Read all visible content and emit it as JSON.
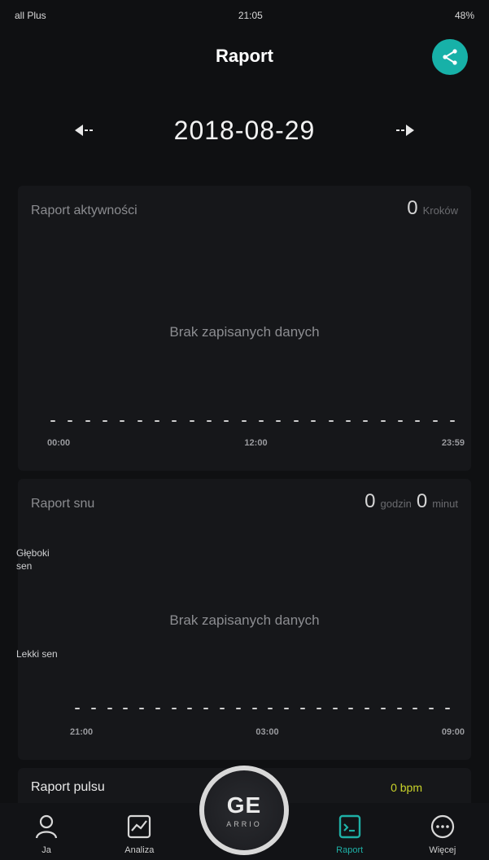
{
  "statusbar": {
    "carrier": "all Plus",
    "time": "21:05",
    "battery": "48%"
  },
  "header": {
    "title": "Raport"
  },
  "date_nav": {
    "date": "2018-08-29"
  },
  "activity": {
    "title": "Raport aktywności",
    "value": "0",
    "unit": "Kroków",
    "no_data": "Brak zapisanych danych",
    "ticks": [
      "00:00",
      "12:00",
      "23:59"
    ]
  },
  "sleep": {
    "title": "Raport snu",
    "hours_value": "0",
    "hours_unit": "godzin",
    "minutes_value": "0",
    "minutes_unit": "minut",
    "deep_label": "Głęboki sen",
    "light_label": "Lekki sen",
    "no_data": "Brak zapisanych danych",
    "ticks": [
      "21:00",
      "03:00",
      "09:00"
    ]
  },
  "pulse": {
    "title": "Raport pulsu",
    "value": "0 bpm"
  },
  "tabs": [
    {
      "label": "Ja"
    },
    {
      "label": "Analiza"
    },
    {
      "label": "Raport"
    },
    {
      "label": "Więcej"
    }
  ],
  "logo": {
    "text": "GE",
    "sub": "ARRIO"
  },
  "colors": {
    "accent": "#1eb0a6",
    "pulse": "#c9d32a",
    "background": "#0f1012"
  }
}
